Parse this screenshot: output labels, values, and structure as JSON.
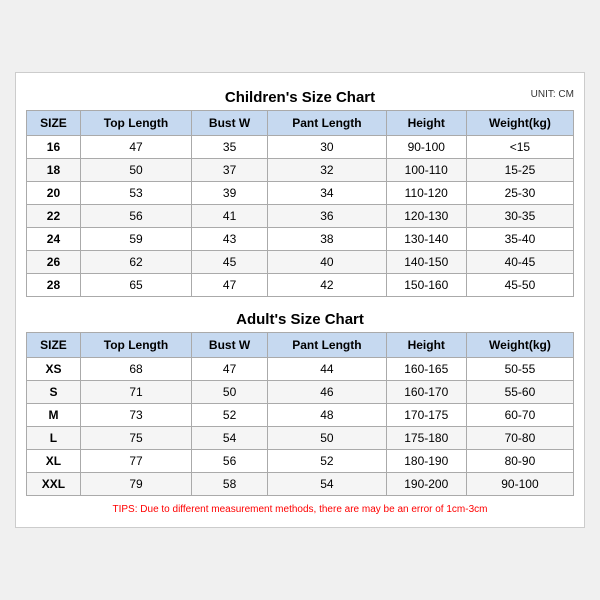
{
  "children_section": {
    "title": "Children's Size Chart",
    "unit": "UNIT: CM",
    "headers": [
      "SIZE",
      "Top Length",
      "Bust W",
      "Pant Length",
      "Height",
      "Weight(kg)"
    ],
    "rows": [
      [
        "16",
        "47",
        "35",
        "30",
        "90-100",
        "<15"
      ],
      [
        "18",
        "50",
        "37",
        "32",
        "100-110",
        "15-25"
      ],
      [
        "20",
        "53",
        "39",
        "34",
        "110-120",
        "25-30"
      ],
      [
        "22",
        "56",
        "41",
        "36",
        "120-130",
        "30-35"
      ],
      [
        "24",
        "59",
        "43",
        "38",
        "130-140",
        "35-40"
      ],
      [
        "26",
        "62",
        "45",
        "40",
        "140-150",
        "40-45"
      ],
      [
        "28",
        "65",
        "47",
        "42",
        "150-160",
        "45-50"
      ]
    ]
  },
  "adult_section": {
    "title": "Adult's Size Chart",
    "headers": [
      "SIZE",
      "Top Length",
      "Bust W",
      "Pant Length",
      "Height",
      "Weight(kg)"
    ],
    "rows": [
      [
        "XS",
        "68",
        "47",
        "44",
        "160-165",
        "50-55"
      ],
      [
        "S",
        "71",
        "50",
        "46",
        "160-170",
        "55-60"
      ],
      [
        "M",
        "73",
        "52",
        "48",
        "170-175",
        "60-70"
      ],
      [
        "L",
        "75",
        "54",
        "50",
        "175-180",
        "70-80"
      ],
      [
        "XL",
        "77",
        "56",
        "52",
        "180-190",
        "80-90"
      ],
      [
        "XXL",
        "79",
        "58",
        "54",
        "190-200",
        "90-100"
      ]
    ]
  },
  "tips": "TIPS: Due to different measurement methods, there are may be an error of 1cm-3cm"
}
